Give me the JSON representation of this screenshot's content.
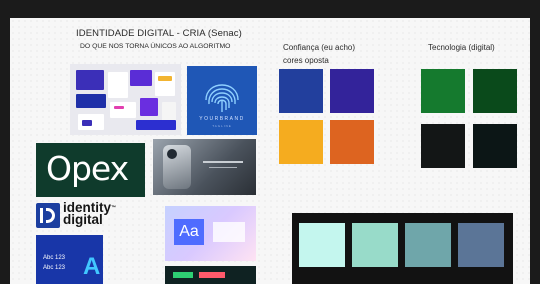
{
  "board": {
    "title_line1": "IDENTIDADE DIGITAL - CRIA (Senac)",
    "title_line2": "DO QUE NOS TORNA ÚNICOS AO ALGORITMO"
  },
  "groups": {
    "trust": {
      "label_line1": "Confiança (eu acho)",
      "label_line2": "cores oposta",
      "colors": [
        "#223f9d",
        "#33239a",
        "#f5ac1f",
        "#dd6420"
      ]
    },
    "tech": {
      "label": "Tecnologia (digital)",
      "colors": [
        "#157a2e",
        "#0a4a1b",
        "#131616",
        "#0c1616"
      ]
    },
    "palette": {
      "colors": [
        "#c4f6ee",
        "#98dbc9",
        "#6fa6aa",
        "#5b7597"
      ]
    }
  },
  "moodboard": {
    "yourbrand_text": "YOURBRAND",
    "yourbrand_sub": "TAGLINE",
    "opex_text": "Opex",
    "identity_line1": "identity",
    "identity_tm": "™",
    "identity_line2": "digital",
    "typo_line1": "Abc 123",
    "typo_line2": "Abc 123",
    "typo_big": "A",
    "aa_text": "Aa"
  }
}
